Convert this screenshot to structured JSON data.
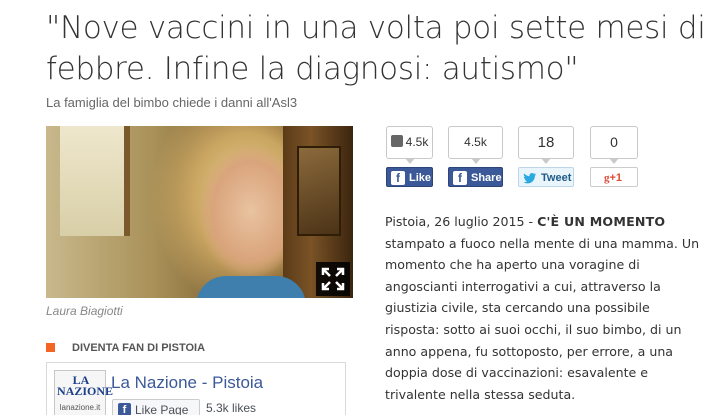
{
  "article": {
    "headline": "\"Nove vaccini in una volta poi sette mesi di febbre. Infine la diagnosi: autismo\"",
    "subheadline": "La famiglia del bimbo chiede i danni all'Asl3",
    "image_caption": "Laura Biagiotti",
    "dateline": "Pistoia, 26 luglio 2015 - ",
    "lead": "C'È UN MOMENTO",
    "body": " stampato a fuoco nella mente di una mamma. Un momento che ha aperto una voragine di angoscianti interrogativi a cui, attraverso la giustizia civile, sta cercando una possibile risposta: sotto ai suoi occhi, il suo bimbo, di un anno appena, fu sottoposto, per errore, a una doppia dose di vaccinazioni: esavalente e trivalente nella stessa seduta."
  },
  "social": {
    "like_count": "4.5k",
    "like_label": "Like",
    "share_count": "4.5k",
    "share_label": "Share",
    "tweet_count": "18",
    "tweet_label": "Tweet",
    "gplus_count": "0",
    "gplus_label": "+1"
  },
  "fan_box": {
    "header": "DIVENTA FAN DI PISTOIA",
    "logo_line1": "LA NAZIONE",
    "logo_line2": "lanazione.it",
    "page_name": "La Nazione - Pistoia",
    "like_page_label": "Like Page",
    "likes": "5.3k likes"
  },
  "colors": {
    "facebook": "#3b5998",
    "twitter": "#2aa9e0",
    "gplus": "#dd4b39",
    "accent": "#f26522"
  },
  "icons": {
    "expand": "expand-icon",
    "thumb": "thumbs-up-icon",
    "facebook": "facebook-icon",
    "twitter": "twitter-bird-icon",
    "gplus": "google-plus-icon"
  }
}
